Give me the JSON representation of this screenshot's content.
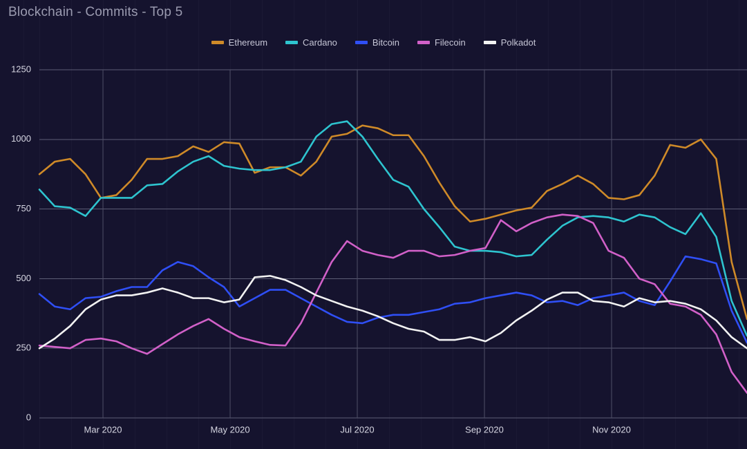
{
  "chart_data": {
    "type": "line",
    "title": "Blockchain - Commits - Top 5",
    "xlabel": "",
    "ylabel": "",
    "ylim": [
      0,
      1250
    ],
    "yticks": [
      0,
      250,
      500,
      750,
      1000,
      1250
    ],
    "xticks": [
      "Mar 2020",
      "May 2020",
      "Jul 2020",
      "Sep 2020",
      "Nov 2020"
    ],
    "xtick_positions": [
      149,
      333,
      517,
      701,
      885
    ],
    "grid": true,
    "legend_position": "top-center",
    "background_color": "#15132e",
    "x": [
      "2020-01-26",
      "2020-02-02",
      "2020-02-09",
      "2020-02-16",
      "2020-02-23",
      "2020-03-01",
      "2020-03-08",
      "2020-03-15",
      "2020-03-22",
      "2020-03-29",
      "2020-04-05",
      "2020-04-12",
      "2020-04-19",
      "2020-04-26",
      "2020-05-03",
      "2020-05-10",
      "2020-05-17",
      "2020-05-24",
      "2020-05-31",
      "2020-06-07",
      "2020-06-14",
      "2020-06-21",
      "2020-06-28",
      "2020-07-05",
      "2020-07-12",
      "2020-07-19",
      "2020-07-26",
      "2020-08-02",
      "2020-08-09",
      "2020-08-16",
      "2020-08-23",
      "2020-08-30",
      "2020-09-06",
      "2020-09-13",
      "2020-09-20",
      "2020-09-27",
      "2020-10-04",
      "2020-10-11",
      "2020-10-18",
      "2020-10-25",
      "2020-11-01",
      "2020-11-08",
      "2020-11-15",
      "2020-11-22",
      "2020-11-29",
      "2020-12-06",
      "2020-12-13"
    ],
    "series": [
      {
        "name": "Ethereum",
        "color": "#cf8a28",
        "values": [
          875,
          920,
          930,
          875,
          790,
          800,
          855,
          930,
          930,
          940,
          975,
          955,
          990,
          985,
          880,
          900,
          900,
          870,
          920,
          1010,
          1020,
          1050,
          1040,
          1015,
          1015,
          940,
          845,
          760,
          705,
          715,
          730,
          745,
          755,
          815,
          840,
          870,
          840,
          790,
          785,
          800,
          870,
          980,
          970,
          1000,
          930,
          560,
          355
        ]
      },
      {
        "name": "Cardano",
        "color": "#2ec4cf",
        "values": [
          820,
          760,
          755,
          725,
          790,
          790,
          790,
          835,
          840,
          885,
          920,
          940,
          905,
          895,
          890,
          890,
          900,
          920,
          1010,
          1055,
          1065,
          1010,
          930,
          855,
          830,
          750,
          685,
          615,
          600,
          600,
          595,
          580,
          585,
          640,
          690,
          720,
          725,
          720,
          705,
          730,
          720,
          685,
          660,
          735,
          650,
          420,
          295
        ]
      },
      {
        "name": "Bitcoin",
        "color": "#2f4ff5",
        "values": [
          445,
          400,
          390,
          430,
          435,
          455,
          470,
          470,
          530,
          560,
          545,
          505,
          470,
          400,
          430,
          460,
          460,
          430,
          400,
          370,
          345,
          340,
          360,
          370,
          370,
          380,
          390,
          410,
          415,
          430,
          440,
          450,
          440,
          415,
          420,
          405,
          430,
          440,
          450,
          420,
          405,
          490,
          580,
          570,
          555,
          385,
          270
        ]
      },
      {
        "name": "Filecoin",
        "color": "#d160c8",
        "values": [
          260,
          255,
          250,
          280,
          285,
          275,
          250,
          230,
          265,
          300,
          330,
          355,
          320,
          290,
          275,
          262,
          260,
          340,
          450,
          560,
          635,
          600,
          585,
          575,
          600,
          600,
          580,
          585,
          600,
          610,
          710,
          670,
          700,
          720,
          730,
          725,
          700,
          600,
          575,
          500,
          480,
          410,
          400,
          370,
          300,
          165,
          90
        ]
      },
      {
        "name": "Polkadot",
        "color": "#f2f2f2",
        "values": [
          250,
          285,
          330,
          390,
          425,
          440,
          440,
          450,
          465,
          450,
          430,
          430,
          415,
          425,
          505,
          510,
          495,
          470,
          440,
          420,
          400,
          385,
          365,
          340,
          320,
          310,
          280,
          280,
          290,
          275,
          305,
          350,
          385,
          425,
          450,
          450,
          420,
          415,
          400,
          430,
          415,
          420,
          410,
          390,
          350,
          290,
          250
        ]
      }
    ]
  },
  "legend": {
    "items": [
      {
        "label": "Ethereum",
        "color": "#cf8a28"
      },
      {
        "label": "Cardano",
        "color": "#2ec4cf"
      },
      {
        "label": "Bitcoin",
        "color": "#2f4ff5"
      },
      {
        "label": "Filecoin",
        "color": "#d160c8"
      },
      {
        "label": "Polkadot",
        "color": "#f2f2f2"
      }
    ]
  }
}
